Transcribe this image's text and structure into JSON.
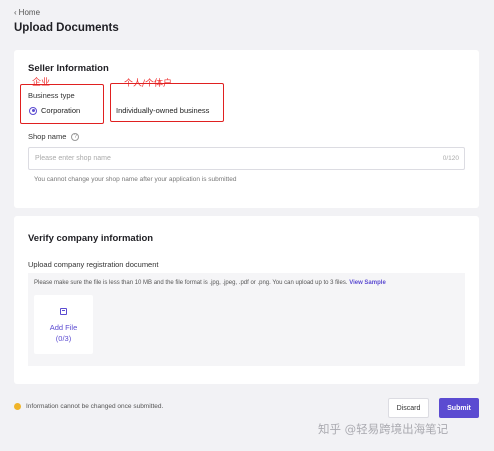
{
  "nav": {
    "back_label": "Home"
  },
  "page": {
    "title": "Upload Documents"
  },
  "seller": {
    "title": "Seller Information",
    "business_type_label": "Business type",
    "options": [
      {
        "label": "Corporation",
        "selected": true
      },
      {
        "label": "Individually-owned business",
        "selected": false
      }
    ],
    "shop_name_label": "Shop name",
    "shop_name_placeholder": "Please enter shop name",
    "shop_name_count": "0/120",
    "shop_name_hint": "You cannot change your shop name after your application is submitted"
  },
  "annotations": {
    "corporation_note": "企业",
    "individual_note": "个人/个体户"
  },
  "verify": {
    "title": "Verify company information",
    "upload_label": "Upload company registration document",
    "upload_note": "Please make sure the file is less than 10 MB and the file format is .jpg, .jpeg, .pdf or .png. You can upload up to 3 files.",
    "sample_link": "View Sample",
    "add_file_label": "Add File",
    "add_file_count": "(0/3)"
  },
  "footer": {
    "info": "Information cannot be changed once submitted.",
    "discard_label": "Discard",
    "submit_label": "Submit"
  },
  "watermark": "知乎 @轻易跨境出海笔记",
  "colors": {
    "accent": "#5b4bd1",
    "annotation": "#e02020",
    "warning": "#f0b429"
  }
}
